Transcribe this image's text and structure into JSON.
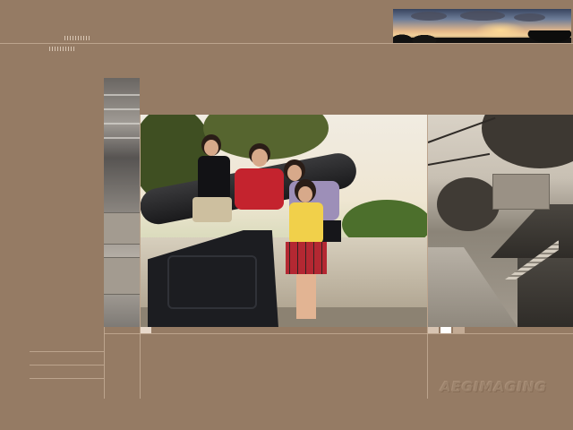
{
  "page": {
    "background": "#957b64",
    "line_color": "#c9b29b"
  },
  "photos": [
    {
      "name": "sunset-panorama",
      "tone": "color"
    },
    {
      "name": "left-strip-grayscale",
      "tone": "grayscale"
    },
    {
      "name": "family-cannon-photo",
      "tone": "color",
      "subjects": 4
    },
    {
      "name": "fortress-path-sepia",
      "tone": "sepia"
    }
  ],
  "swatches": [
    "#e8d9cb",
    "#d7c4b2",
    "#ffffff",
    "#c3ab95"
  ],
  "watermark": {
    "text": "AEGIMAGING",
    "color": "#9c836c"
  }
}
